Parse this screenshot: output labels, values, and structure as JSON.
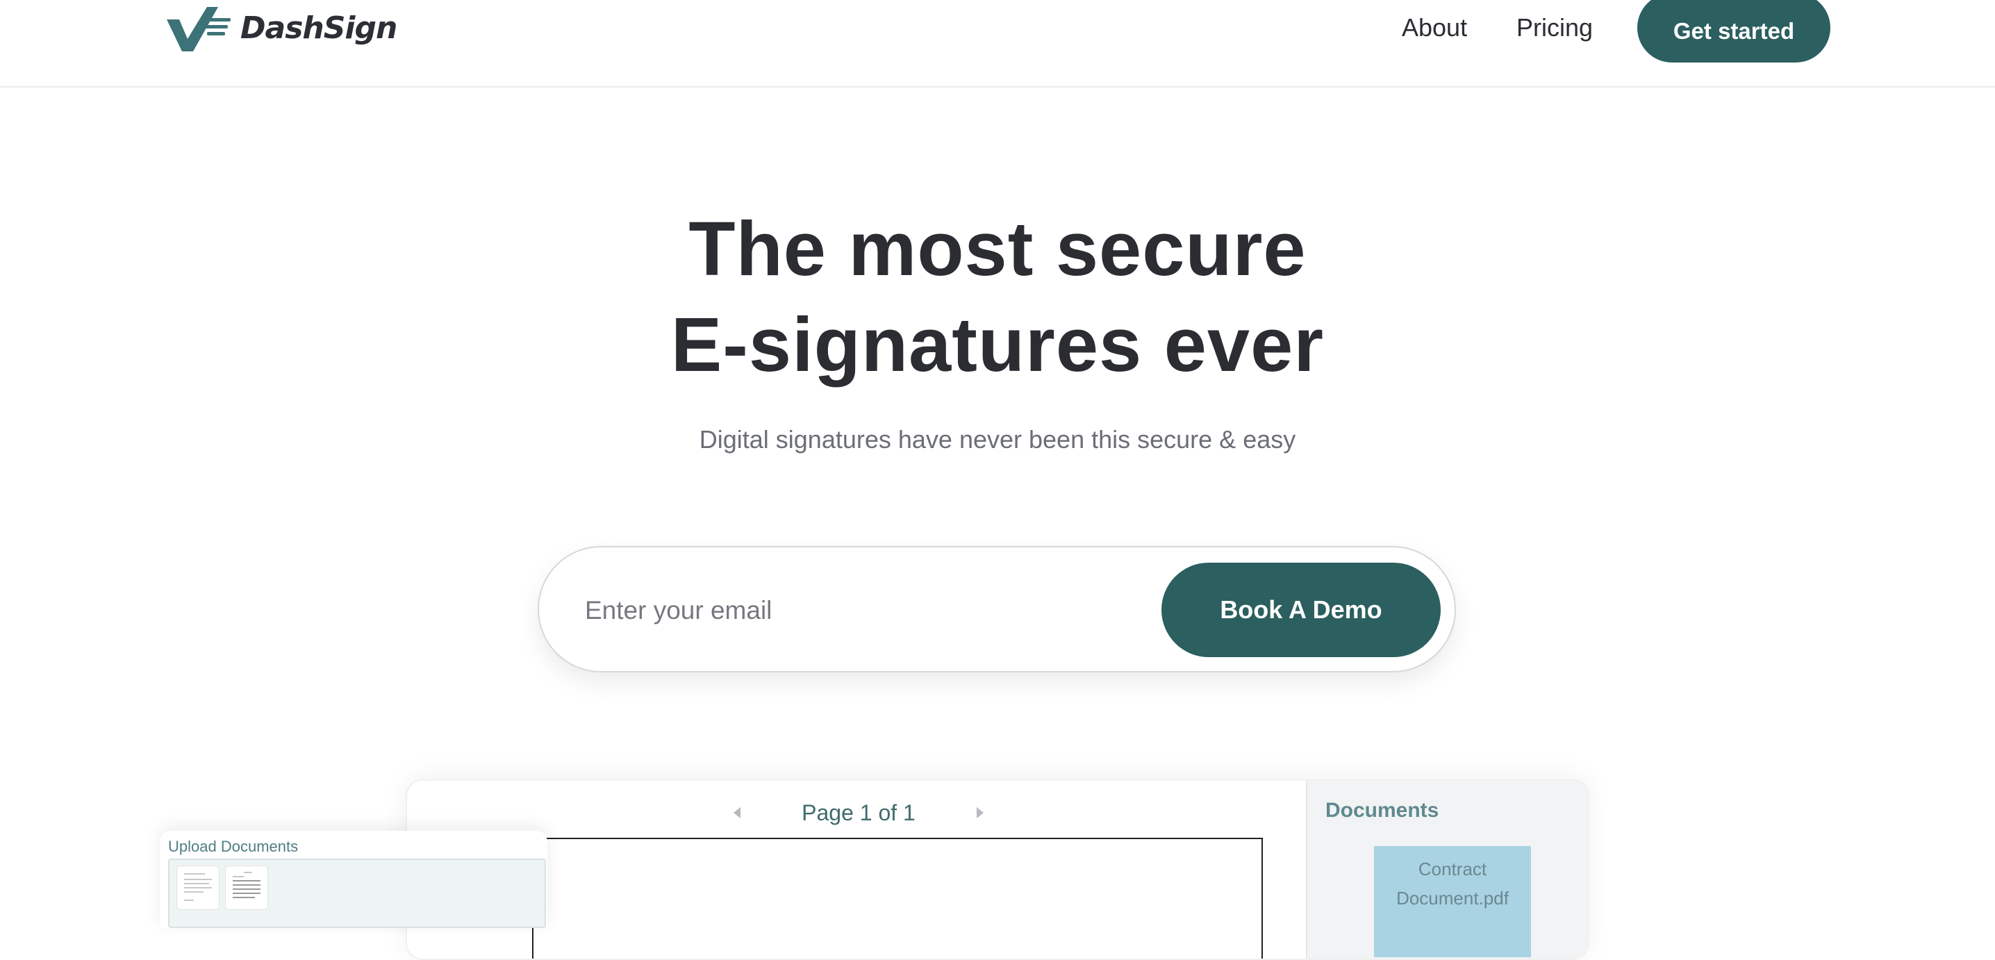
{
  "header": {
    "brand": "DashSign",
    "logo_icon": "checkmark-dash-logo-icon",
    "nav": [
      {
        "label": "About"
      },
      {
        "label": "Pricing"
      }
    ],
    "cta_label": "Get started"
  },
  "hero": {
    "headline_line1": "The most secure",
    "headline_line2": "E-signatures ever",
    "subheadline": "Digital signatures have never been this secure & easy",
    "email_placeholder": "Enter your email",
    "demo_button_label": "Book A Demo"
  },
  "preview": {
    "pager_label": "Page 1 of 1",
    "documents_title": "Documents",
    "document_card_label": "Contract Document.pdf",
    "upload_title": "Upload Documents"
  },
  "colors": {
    "brand_primary": "#2c5f5f",
    "text_dark": "#2b2d33",
    "text_muted": "#6b6e76",
    "doc_card_bg": "#a9d3e2"
  }
}
